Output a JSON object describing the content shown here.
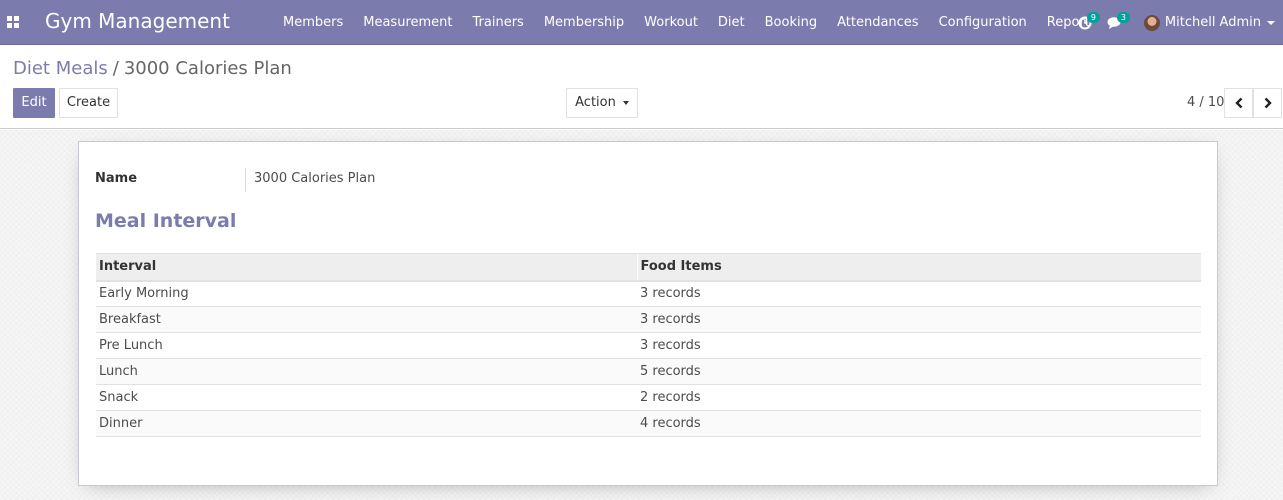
{
  "navbar": {
    "brand": "Gym Management",
    "menu": [
      "Members",
      "Measurement",
      "Trainers",
      "Membership",
      "Workout",
      "Diet",
      "Booking",
      "Attendances",
      "Configuration",
      "Report"
    ],
    "activities_count": "9",
    "messages_count": "3",
    "user_name": "Mitchell Admin"
  },
  "breadcrumb": {
    "parent": "Diet Meals",
    "separator": "/",
    "current": "3000 Calories Plan"
  },
  "buttons": {
    "edit": "Edit",
    "create": "Create",
    "action": "Action"
  },
  "pager": {
    "value": "4 / 10"
  },
  "form": {
    "name_label": "Name",
    "name_value": "3000 Calories Plan",
    "section_title": "Meal Interval"
  },
  "table": {
    "headers": [
      "Interval",
      "Food Items"
    ],
    "rows": [
      {
        "interval": "Early Morning",
        "food_items": "3 records"
      },
      {
        "interval": "Breakfast",
        "food_items": "3 records"
      },
      {
        "interval": "Pre Lunch",
        "food_items": "3 records"
      },
      {
        "interval": "Lunch",
        "food_items": "5 records"
      },
      {
        "interval": "Snack",
        "food_items": "2 records"
      },
      {
        "interval": "Dinner",
        "food_items": "4 records"
      }
    ]
  },
  "colors": {
    "primary": "#7c7bad",
    "badge": "#00a09d"
  }
}
